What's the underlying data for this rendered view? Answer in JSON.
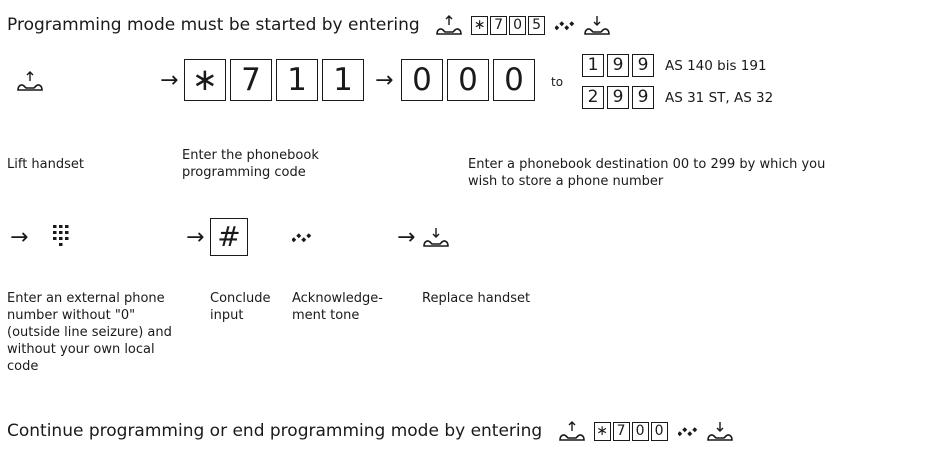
{
  "intro": {
    "text": "Programming mode must be started by entering",
    "keys": [
      "∗",
      "7",
      "0",
      "5"
    ]
  },
  "step1": {
    "arrow": "→",
    "code_keys": [
      "∗",
      "7",
      "1",
      "1"
    ],
    "dest_keys": [
      "0",
      "0",
      "0"
    ],
    "to_label": "to",
    "range_a_keys": [
      "1",
      "9",
      "9"
    ],
    "range_a_label": "AS 140 bis 191",
    "range_b_keys": [
      "2",
      "9",
      "9"
    ],
    "range_b_label": "AS 31 ST, AS 32"
  },
  "captions1": {
    "lift": "Lift handset",
    "enter_code": "Enter the phonebook programming code",
    "enter_dest": "Enter a phonebook destination 00  to 299 by which you wish to store a phone number"
  },
  "step2": {
    "hash_key": "#",
    "captions": {
      "external": "Enter an external phone number without \"0\" (outside line seizure) and without your own local code",
      "conclude": "Conclude input",
      "ack": "Acknowledge-ment tone",
      "replace": "Replace handset"
    }
  },
  "outro": {
    "text": "Continue programming or end programming mode by entering",
    "keys": [
      "∗",
      "7",
      "0",
      "0"
    ]
  },
  "icons": {
    "lift_handset": "handset-lift-icon",
    "replace_handset": "handset-replace-icon",
    "ack_tone": "acknowledgement-tone-icon",
    "keypad": "keypad-icon"
  }
}
